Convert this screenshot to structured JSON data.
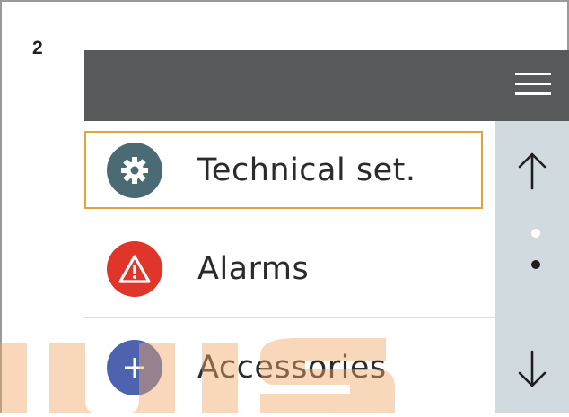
{
  "step": {
    "number": "2"
  },
  "header": {
    "menu_icon": "hamburger-menu-icon"
  },
  "menu_items": [
    {
      "label": "Technical set.",
      "icon": "gear-icon",
      "icon_bg": "#4a6b74",
      "selected": true
    },
    {
      "label": "Alarms",
      "icon": "warning-triangle-icon",
      "icon_bg": "#e0352b",
      "selected": false
    },
    {
      "label": "Accessories",
      "icon": "plus-icon",
      "icon_bg": "#4d63b0",
      "selected": false
    }
  ],
  "scroll": {
    "up_icon": "arrow-up-icon",
    "down_icon": "arrow-down-icon",
    "page_count": 2,
    "current_page": 2
  },
  "colors": {
    "header": "#58595b",
    "selection_border": "#e3a33a",
    "scroll_panel": "#d1dade",
    "watermark": "#f0a868"
  }
}
